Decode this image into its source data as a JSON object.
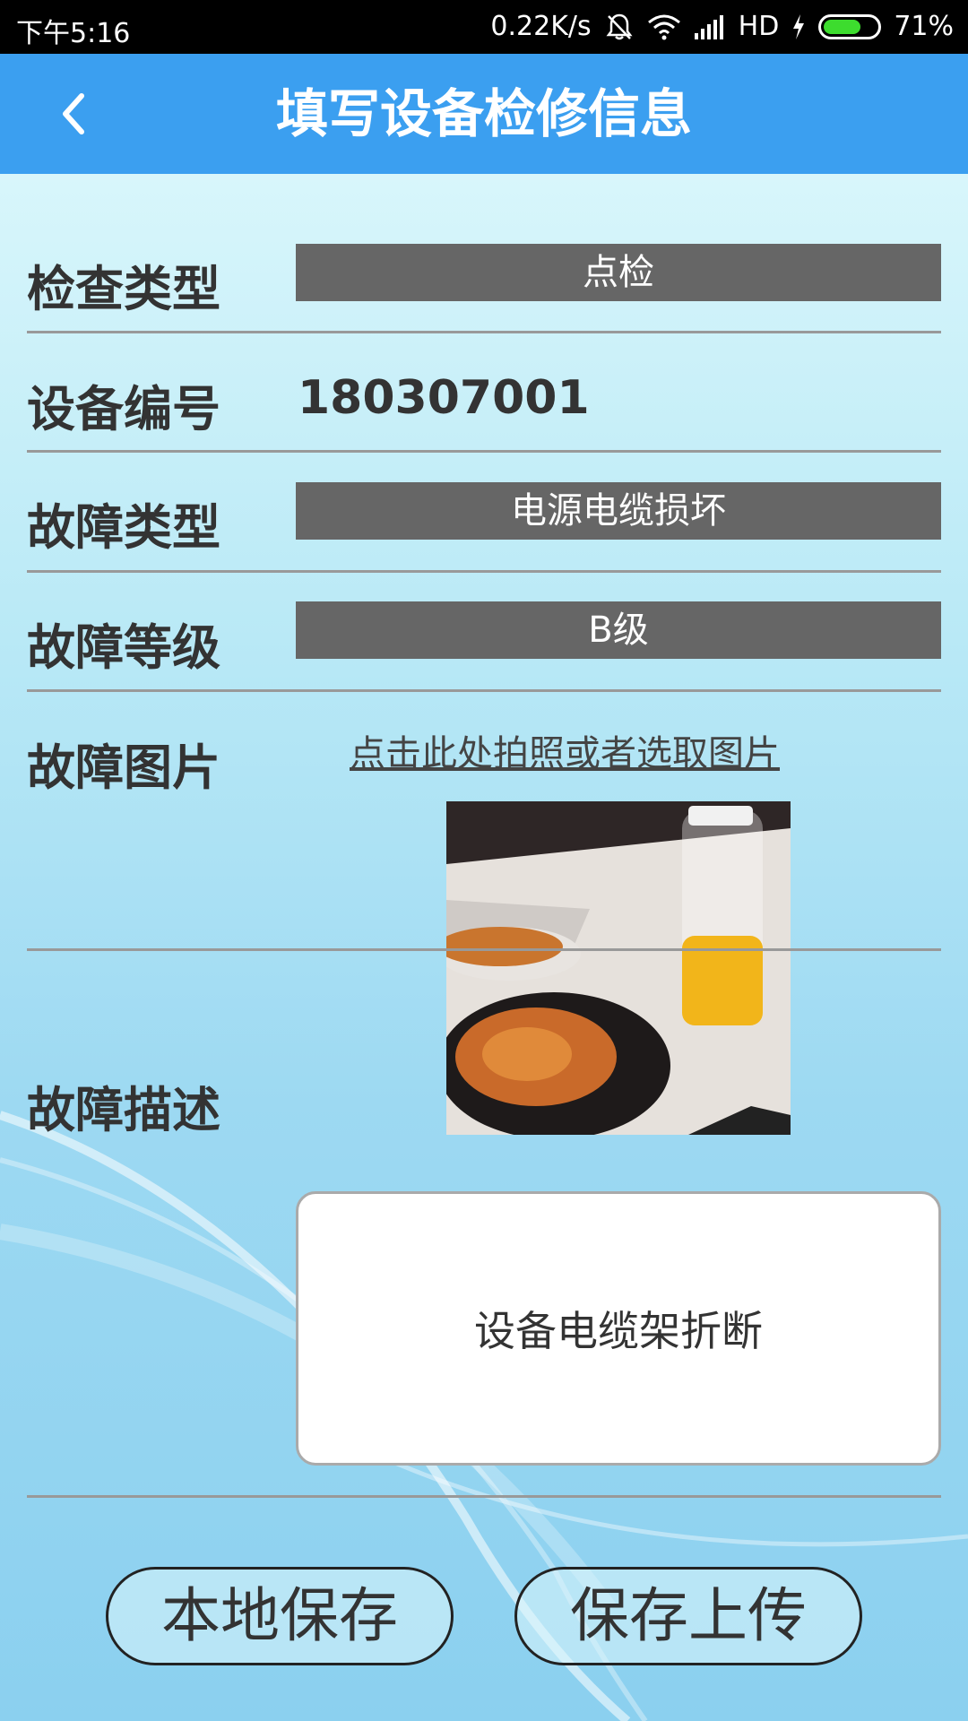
{
  "status_bar": {
    "time": "下午5:16",
    "net_speed": "0.22K/s",
    "network": "HD",
    "battery_percent": "71%",
    "battery_level": 0.71
  },
  "header": {
    "title": "填写设备检修信息",
    "back_icon": "chevron-left-icon"
  },
  "form": {
    "inspection_type": {
      "label": "检查类型",
      "value": "点检"
    },
    "device_number": {
      "label": "设备编号",
      "value": "180307001"
    },
    "fault_type": {
      "label": "故障类型",
      "value": "电源电缆损坏"
    },
    "fault_level": {
      "label": "故障等级",
      "value": "B级"
    },
    "fault_image": {
      "label": "故障图片",
      "link": "点击此处拍照或者选取图片"
    },
    "fault_description": {
      "label": "故障描述",
      "value": "设备电缆架折断"
    }
  },
  "actions": {
    "local_save": "本地保存",
    "save_upload": "保存上传"
  },
  "colors": {
    "header": "#3b9ff0",
    "select_bg": "#666666",
    "battery": "#3ddc2e"
  }
}
